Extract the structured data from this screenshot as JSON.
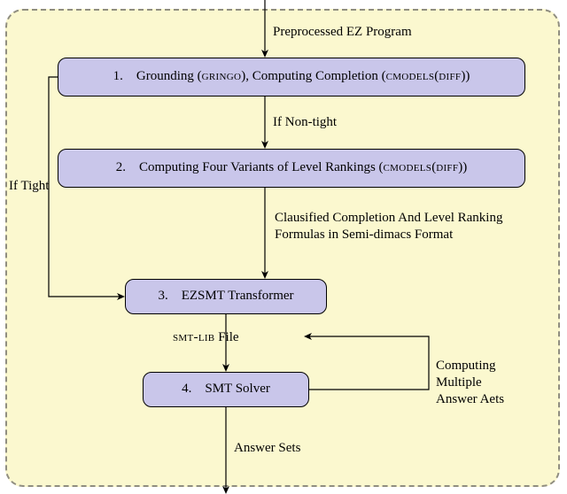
{
  "labels": {
    "input": "Preprocessed EZ Program",
    "if_nontight": "If Non-tight",
    "if_tight": "If Tight",
    "clausified_l1": "Clausified Completion And Level Ranking",
    "clausified_l2": "Formulas in Semi-dimacs Format",
    "smtlib_file_prefix": "smt-lib",
    "smtlib_file_suffix": " File",
    "multi_l1": "Computing",
    "multi_l2": "Multiple",
    "multi_l3": "Answer Aets",
    "output": "Answer Sets"
  },
  "nodes": {
    "n1_prefix": "1. Grounding (",
    "n1_gringo": "gringo",
    "n1_mid": "), Computing Completion (",
    "n1_cmodels": "cmodels",
    "n1_diff_open": "(",
    "n1_diff": "diff",
    "n1_diff_close": ")",
    "n1_suffix": ")",
    "n2_prefix": "2. Computing Four Variants of Level Rankings (",
    "n2_cmodels": "cmodels",
    "n2_diff_open": "(",
    "n2_diff": "diff",
    "n2_diff_close": ")",
    "n2_suffix": ")",
    "n3": "3. EZSMT Transformer",
    "n4": "4. SMT Solver"
  }
}
